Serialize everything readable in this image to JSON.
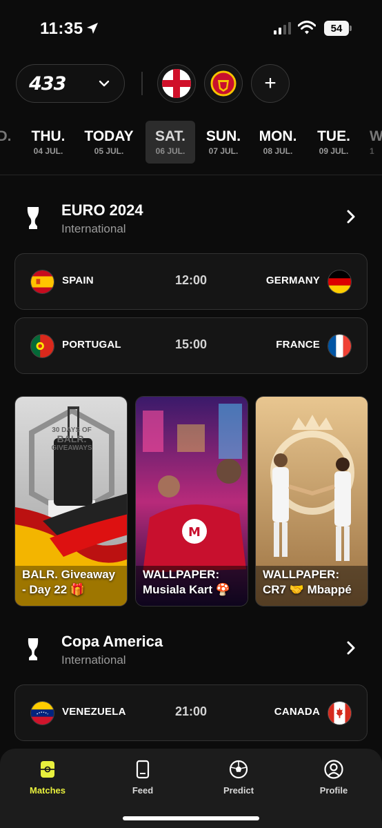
{
  "status": {
    "time": "11:35",
    "battery": "54"
  },
  "brand": {
    "logo": "433"
  },
  "dates": [
    {
      "day": "D.",
      "sub": ""
    },
    {
      "day": "THU.",
      "sub": "04 JUL."
    },
    {
      "day": "TODAY",
      "sub": "05 JUL."
    },
    {
      "day": "SAT.",
      "sub": "06 JUL."
    },
    {
      "day": "SUN.",
      "sub": "07 JUL."
    },
    {
      "day": "MON.",
      "sub": "08 JUL."
    },
    {
      "day": "TUE.",
      "sub": "09 JUL."
    },
    {
      "day": "W",
      "sub": "1"
    }
  ],
  "competitions": [
    {
      "title": "EURO 2024",
      "subtitle": "International",
      "matches": [
        {
          "home": "SPAIN",
          "time": "12:00",
          "away": "GERMANY"
        },
        {
          "home": "PORTUGAL",
          "time": "15:00",
          "away": "FRANCE"
        }
      ]
    },
    {
      "title": "Copa America",
      "subtitle": "International",
      "matches": [
        {
          "home": "VENEZUELA",
          "time": "21:00",
          "away": "CANADA"
        }
      ]
    }
  ],
  "promos": [
    {
      "line1": "BALR. Giveaway",
      "line2": "- Day 22 🎁",
      "tag1": "30 DAYS OF",
      "tag2": "BALR.",
      "tag3": "GIVEAWAYS"
    },
    {
      "line1": "WALLPAPER:",
      "line2": "Musiala Kart 🍄"
    },
    {
      "line1": "WALLPAPER:",
      "line2": "CR7 🤝 Mbappé"
    }
  ],
  "nav": [
    {
      "label": "Matches",
      "icon": "pitch-icon"
    },
    {
      "label": "Feed",
      "icon": "phone-icon"
    },
    {
      "label": "Predict",
      "icon": "ball-icon"
    },
    {
      "label": "Profile",
      "icon": "profile-icon"
    }
  ],
  "colors": {
    "accent": "#e8f03d",
    "background": "#0c0c0c",
    "card": "#151515"
  }
}
